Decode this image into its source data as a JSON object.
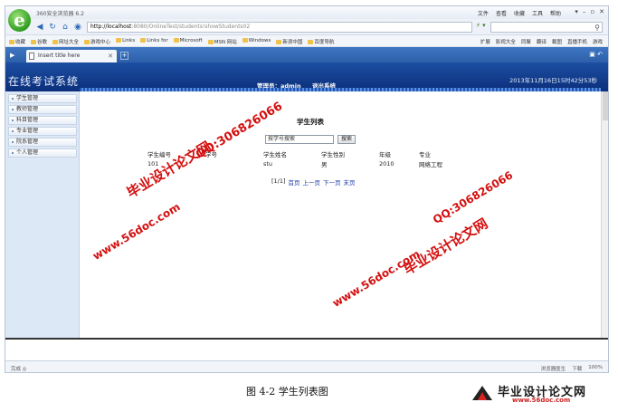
{
  "browser": {
    "app_title": "360安全浏览器 6.2",
    "menu": [
      "文件",
      "查看",
      "收藏",
      "工具",
      "帮助"
    ],
    "address_host": "http://localhost",
    "address_path": ":8080/OnlineTest/students!showStudents02",
    "favorites_left": [
      "收藏",
      "谷歌",
      "网址大全",
      "游戏中心",
      "Links",
      "Links for",
      "Microsoft",
      "MSN 网站",
      "Windows",
      "新浪中国",
      "百度导航"
    ],
    "favorites_right": [
      "扩展",
      "影视大全",
      "同聚",
      "翻译",
      "截图",
      "直播手机",
      "游戏"
    ],
    "tab_title": "Insert title here",
    "status_left": "完成 ◎",
    "status_right": [
      "浏览器医生",
      "下载",
      "100%"
    ]
  },
  "page": {
    "system_title": "在线考试系统",
    "admin_label": "管理员：admin",
    "logout_label": "退出系统",
    "datetime": "2013年11月16日15时42分53秒",
    "sidebar_items": [
      "学生管理",
      "教师管理",
      "科目管理",
      "专业管理",
      "院系管理",
      "个人管理"
    ],
    "list_title": "学生列表",
    "search_value": "按学号搜索",
    "search_button": "搜索",
    "table": {
      "headers": [
        "学生编号",
        "学号",
        "学生姓名",
        "学生性别",
        "年级",
        "专业"
      ],
      "rows": [
        [
          "101",
          "",
          "stu",
          "男",
          "2010",
          "网络工程"
        ]
      ]
    },
    "pager": {
      "info": "[1/1]",
      "first": "首页",
      "prev": "上一页",
      "next": "下一页",
      "last": "末页"
    }
  },
  "watermarks": [
    "毕业设计论文网",
    "QQ:306826066",
    "www.56doc.com",
    "www.56doc.com",
    "毕业设计论文网",
    "QQ:306826066"
  ],
  "caption": "图 4-2 学生列表图",
  "brand": {
    "name": "毕业设计论文网",
    "url": "www.56doc.com"
  }
}
